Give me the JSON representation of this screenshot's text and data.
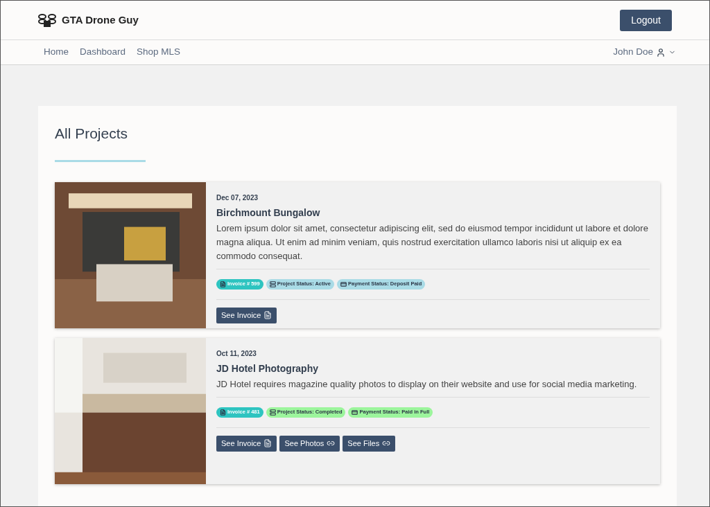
{
  "header": {
    "brand": "GTA Drone Guy",
    "logout": "Logout"
  },
  "nav": {
    "links": [
      "Home",
      "Dashboard",
      "Shop MLS"
    ],
    "user": "John Doe"
  },
  "page": {
    "title": "All Projects"
  },
  "projects": [
    {
      "date": "Dec 07, 2023",
      "name": "Birchmount Bungalow",
      "description": "Lorem ipsum dolor sit amet, consectetur adipiscing elit, sed do eiusmod tempor incididunt ut labore et dolore magna aliqua. Ut enim ad minim veniam, quis nostrud exercitation ullamco laboris nisi ut aliquip ex ea commodo consequat.",
      "kind": "living",
      "badges": [
        {
          "kind": "invoice",
          "label": "Invoice # 599",
          "color": "#2ec4c0"
        },
        {
          "kind": "project",
          "label": "Project Status: Active",
          "color": "#a9dbe6"
        },
        {
          "kind": "payment",
          "label": "Payment Status: Deposit Paid",
          "color": "#a9dbe6"
        }
      ],
      "buttons": [
        {
          "kind": "invoice",
          "label": "See Invoice"
        }
      ]
    },
    {
      "date": "Oct 11, 2023",
      "name": "JD Hotel Photography",
      "description": "JD Hotel requires magazine quality photos to display on their website and use for social media marketing.",
      "kind": "kitchen",
      "badges": [
        {
          "kind": "invoice",
          "label": "Invoice # 481",
          "color": "#2ec4c0"
        },
        {
          "kind": "project",
          "label": "Project Status: Completed",
          "color": "#9cf59c"
        },
        {
          "kind": "payment",
          "label": "Payment Status: Paid in Full",
          "color": "#9cf59c"
        }
      ],
      "buttons": [
        {
          "kind": "invoice",
          "label": "See Invoice"
        },
        {
          "kind": "link",
          "label": "See Photos"
        },
        {
          "kind": "link",
          "label": "See Files"
        }
      ]
    }
  ]
}
